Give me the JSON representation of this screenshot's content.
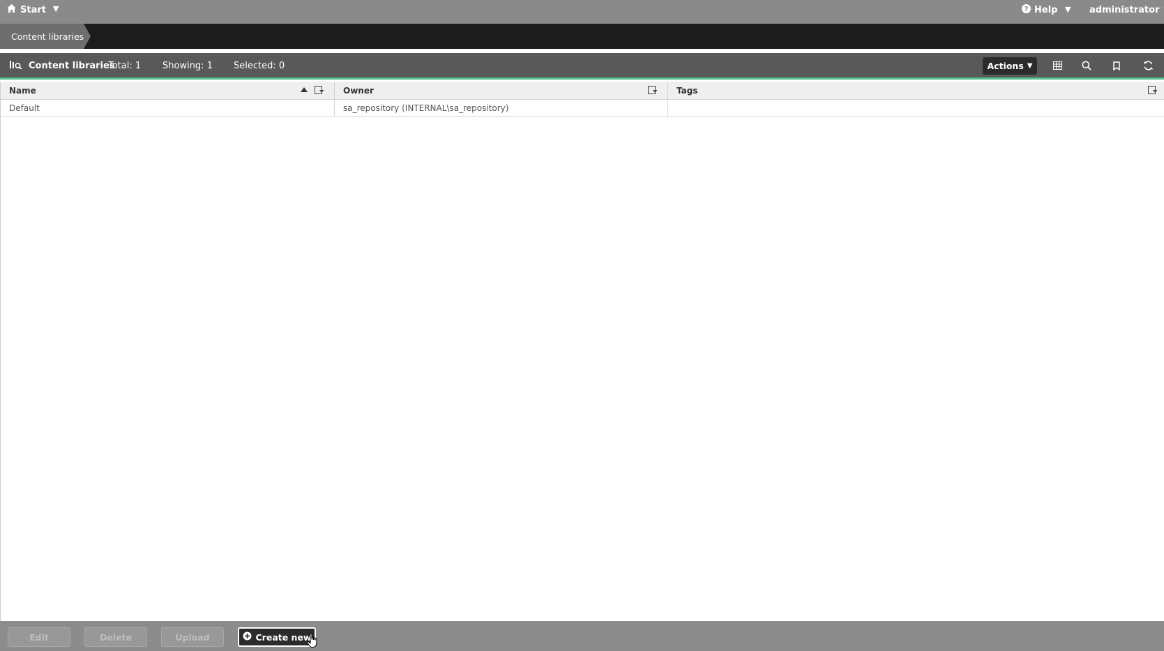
{
  "topbar": {
    "start_label": "Start",
    "help_label": "Help",
    "user_label": "administrator"
  },
  "breadcrumb": {
    "current": "Content libraries"
  },
  "toolbar": {
    "title": "Content libraries",
    "total": "Total: 1",
    "showing": "Showing: 1",
    "selected": "Selected: 0",
    "actions_label": "Actions"
  },
  "table": {
    "columns": [
      "Name",
      "Owner",
      "Tags"
    ],
    "rows": [
      {
        "name": "Default",
        "owner": "sa_repository (INTERNAL\\sa_repository)",
        "tags": ""
      }
    ]
  },
  "footer": {
    "edit_label": "Edit",
    "delete_label": "Delete",
    "upload_label": "Upload",
    "create_label": "Create new"
  },
  "colors": {
    "accent": "#52c28a",
    "topbar": "#8a8a8a",
    "breadcrumb_bar": "#1c1c1c",
    "toolbar": "#595959"
  }
}
